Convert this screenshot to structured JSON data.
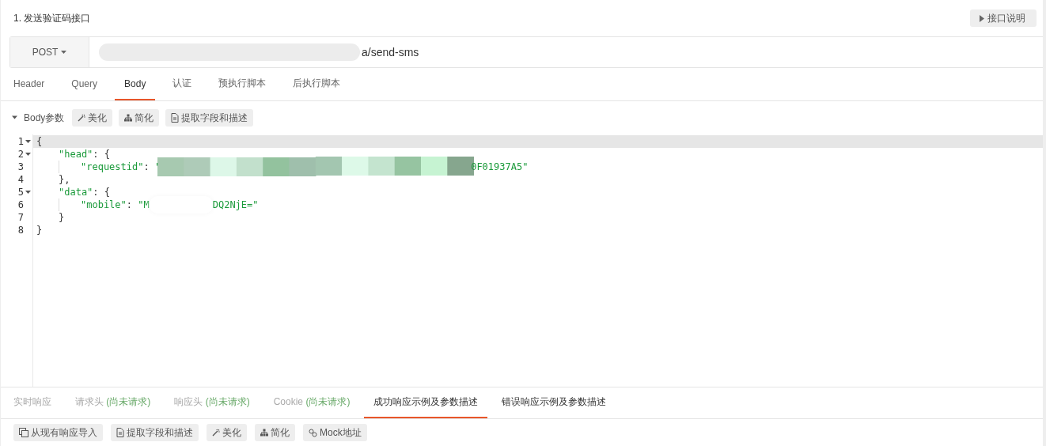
{
  "title": "1. 发送验证码接口",
  "doc_button": {
    "label": "接口说明"
  },
  "request": {
    "method": "POST",
    "url_prefix": "a",
    "url": "/send-sms"
  },
  "tabs": [
    {
      "label": "Header",
      "selected": false
    },
    {
      "label": "Query",
      "selected": false
    },
    {
      "label": "Body",
      "selected": true
    },
    {
      "label": "认证",
      "selected": false
    },
    {
      "label": "预执行脚本",
      "selected": false
    },
    {
      "label": "后执行脚本",
      "selected": false
    }
  ],
  "body_toolbar": {
    "label": "Body参数",
    "expanded": true,
    "buttons": [
      {
        "kind": "beautify",
        "label": "美化"
      },
      {
        "kind": "simplify",
        "label": "简化"
      },
      {
        "kind": "extract",
        "label": "提取字段和描述"
      }
    ]
  },
  "editor": {
    "lines": [
      {
        "number": "1",
        "foldable": true,
        "highlighted": true,
        "segments": [
          {
            "kind": "punct",
            "text": "{"
          }
        ],
        "children": [
          {
            "number": "2",
            "foldable": true,
            "highlighted": false,
            "segments": [
              {
                "kind": "key",
                "text": "\"head\""
              },
              {
                "kind": "punct",
                "text": ": {"
              }
            ],
            "children": [
              {
                "number": "3",
                "foldable": false,
                "highlighted": false,
                "segments": [
                  {
                    "kind": "key",
                    "text": "\"requestid\""
                  },
                  {
                    "kind": "punct",
                    "text": ": "
                  },
                  {
                    "kind": "string",
                    "text": "\""
                  },
                  {
                    "kind": "pixel_mask"
                  },
                  {
                    "kind": "string",
                    "text": "0F01937A5\""
                  }
                ]
              }
            ]
          },
          {
            "number": "4",
            "foldable": false,
            "highlighted": false,
            "segments": [
              {
                "kind": "punct",
                "text": "},"
              }
            ]
          },
          {
            "number": "5",
            "foldable": true,
            "highlighted": false,
            "segments": [
              {
                "kind": "key",
                "text": "\"data\""
              },
              {
                "kind": "punct",
                "text": ": {"
              }
            ],
            "children": [
              {
                "number": "6",
                "foldable": false,
                "highlighted": false,
                "segments": [
                  {
                    "kind": "key",
                    "text": "\"mobile\""
                  },
                  {
                    "kind": "punct",
                    "text": ": "
                  },
                  {
                    "kind": "string",
                    "text": "\"M"
                  },
                  {
                    "kind": "blank_mask"
                  },
                  {
                    "kind": "string",
                    "text": "DQ2NjE=\""
                  }
                ]
              }
            ]
          },
          {
            "number": "7",
            "foldable": false,
            "highlighted": false,
            "segments": [
              {
                "kind": "punct",
                "text": "}"
              }
            ]
          }
        ]
      },
      {
        "number": "8",
        "foldable": false,
        "highlighted": false,
        "segments": [
          {
            "kind": "punct",
            "text": "}"
          }
        ]
      }
    ]
  },
  "response_tabs": [
    {
      "label": "实时响应",
      "disabled": true,
      "selected": false
    },
    {
      "label": "请求头",
      "note": "(尚未请求)",
      "disabled": true,
      "selected": false
    },
    {
      "label": "响应头",
      "note": "(尚未请求)",
      "disabled": true,
      "selected": false
    },
    {
      "label": "Cookie",
      "note": "(尚未请求)",
      "disabled": true,
      "selected": false
    },
    {
      "label": "成功响应示例及参数描述",
      "disabled": false,
      "selected": true
    },
    {
      "label": "错误响应示例及参数描述",
      "disabled": false,
      "selected": false
    }
  ],
  "response_toolbar": [
    {
      "kind": "import",
      "label": "从现有响应导入"
    },
    {
      "kind": "extract",
      "label": "提取字段和描述"
    },
    {
      "kind": "beautify",
      "label": "美化"
    },
    {
      "kind": "simplify",
      "label": "简化"
    },
    {
      "kind": "mock",
      "label": "Mock地址"
    }
  ]
}
